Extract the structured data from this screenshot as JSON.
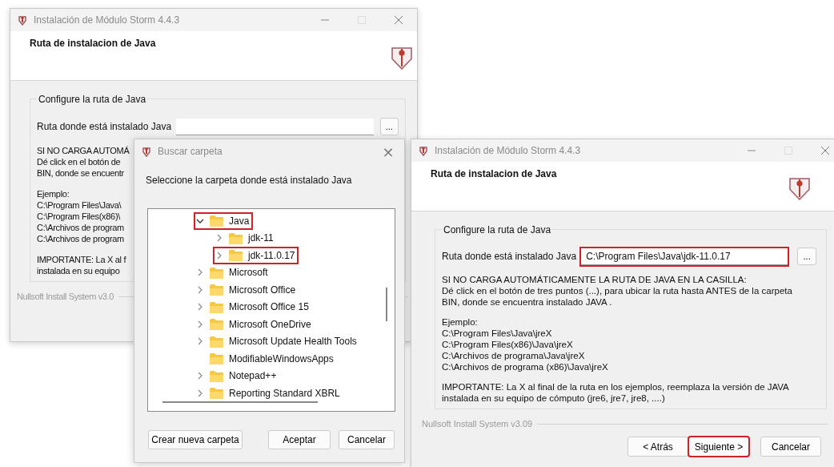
{
  "installer_back": {
    "title": "Instalación de Módulo Storm 4.4.3",
    "heading": "Ruta de instalacion de Java",
    "group_title": "Configure la ruta de Java",
    "path_label": "Ruta donde está instalado Java",
    "browse_button": "...",
    "paragraphs": [
      [
        "SI NO CARGA AUTOMÁ",
        "Dé click en el botón de",
        "BIN, donde se encuentr"
      ],
      [
        "Ejemplo:",
        "C:\\Program Files\\Java\\",
        "C:\\Program Files(x86)\\",
        "C:\\Archivos de program",
        "C:\\Archivos de program"
      ],
      [
        "IMPORTANTE: La X al f",
        "instalada en su equipo"
      ]
    ],
    "footer": "Nullsoft Install System v3.0"
  },
  "folder_dialog": {
    "title": "Buscar carpeta",
    "close_button": "×",
    "prompt": "Seleccione la carpeta donde está instalado Java",
    "tree": [
      {
        "label": "Java",
        "kind": "branch",
        "expanded": true,
        "highlighted": true,
        "children": [
          {
            "label": "jdk-11",
            "kind": "branch",
            "expanded": false,
            "highlighted": false
          },
          {
            "label": "jdk-11.0.17",
            "kind": "branch",
            "expanded": false,
            "highlighted": true
          }
        ]
      },
      {
        "label": "Microsoft",
        "kind": "branch",
        "expanded": false,
        "highlighted": false
      },
      {
        "label": "Microsoft Office",
        "kind": "branch",
        "expanded": false,
        "highlighted": false
      },
      {
        "label": "Microsoft Office 15",
        "kind": "branch",
        "expanded": false,
        "highlighted": false
      },
      {
        "label": "Microsoft OneDrive",
        "kind": "branch",
        "expanded": false,
        "highlighted": false
      },
      {
        "label": "Microsoft Update Health Tools",
        "kind": "branch",
        "expanded": false,
        "highlighted": false
      },
      {
        "label": "ModifiableWindowsApps",
        "kind": "leaf",
        "highlighted": false
      },
      {
        "label": "Notepad++",
        "kind": "branch",
        "expanded": false,
        "highlighted": false
      },
      {
        "label": "Reporting Standard XBRL",
        "kind": "branch",
        "expanded": false,
        "highlighted": false
      }
    ],
    "buttons": [
      "Crear nueva carpeta",
      "Aceptar",
      "Cancelar"
    ]
  },
  "installer_front": {
    "title": "Instalación de Módulo Storm 4.4.3",
    "heading": "Ruta de instalacion de Java",
    "group_title": "Configure la ruta de Java",
    "path_label": "Ruta donde está instalado Java",
    "path_value": {
      "text": "C:\\Program Files\\Java\\jdk-11.0.17",
      "highlighted": true
    },
    "browse_button": "...",
    "paragraphs": [
      [
        "SI NO CARGA AUTOMÁTICAMENTE LA RUTA DE JAVA EN LA CASILLA:",
        "Dé click en el botón de tres puntos (...), para ubicar la ruta hasta ANTES de la carpeta",
        "BIN, donde se encuentra instalado JAVA ."
      ],
      [
        "Ejemplo:",
        "C:\\Program Files\\Java\\jreX",
        "C:\\Program Files(x86)\\Java\\jreX",
        "C:\\Archivos de programa\\Java\\jreX",
        "C:\\Archivos de programa (x86)\\Java\\jreX"
      ],
      [
        "IMPORTANTE: La X al final de la ruta en los ejemplos, reemplaza la versión de JAVA",
        "instalada en su equipo de cómputo (jre6, jre7, jre8, ....)"
      ]
    ],
    "footer": "Nullsoft Install System v3.09",
    "buttons": [
      {
        "label": "< Atrás",
        "highlighted": false
      },
      {
        "label": "Siguiente >",
        "highlighted": true
      },
      {
        "label": "Cancelar",
        "highlighted": false
      }
    ]
  }
}
